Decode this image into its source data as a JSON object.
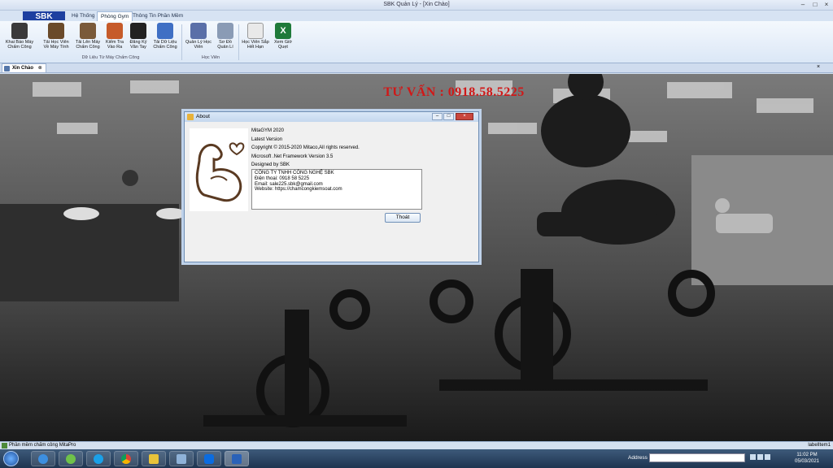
{
  "window": {
    "title": "SBK Quản Lý - [Xin Chào]"
  },
  "ribbon": {
    "tabs": [
      "Hệ Thống",
      "Phòng Gym",
      "Thông Tin Phần Mềm"
    ],
    "active_tab": "Phòng Gym",
    "buttons": [
      "Khai Báo Máy Chấm Công",
      "Tải Học Viên Về Máy Tính",
      "Tải Lên Máy Chấm Công",
      "Kiểm Tra Vào Ra",
      "Đăng Ký Vân Tay",
      "Tải Dữ Liệu Chấm Công",
      "Quản Lý Học Viên",
      "Sơ Đồ Quản Lí",
      "Học Viên Sắp Hết Hạn",
      "Xem Giờ Quẹt"
    ],
    "groups": [
      "Dữ Liệu Từ Máy Chấm Công",
      "Học Viên"
    ]
  },
  "doc_tab": {
    "label": "Xin Chào"
  },
  "banner": {
    "text": "TƯ VẤN : 0918.58.5225"
  },
  "about": {
    "title": "About",
    "product": "MitaGYM 2020",
    "version": "Latest Version",
    "copyright": "Copyright © 2015-2020 Mitaco,All rights reserved.",
    "framework": "Microsoft .Net Framework Version 3.5",
    "designed_by": "Designed by SBK",
    "details": [
      "CÔNG TY TNHH CÔNG NGHỆ SBK",
      "Điện thoại: 0918 58 5225",
      "Email: sale225.sbk@gmail.com",
      "Website: https://chamcongkiemsoat.com"
    ],
    "close_label": "Thoát"
  },
  "status": {
    "left": "Phần mềm chấm công MitaPro",
    "right": "labelItem1"
  },
  "taskbar": {
    "address_label": "Address",
    "time": "11:02 PM",
    "date": "05/03/2021"
  }
}
